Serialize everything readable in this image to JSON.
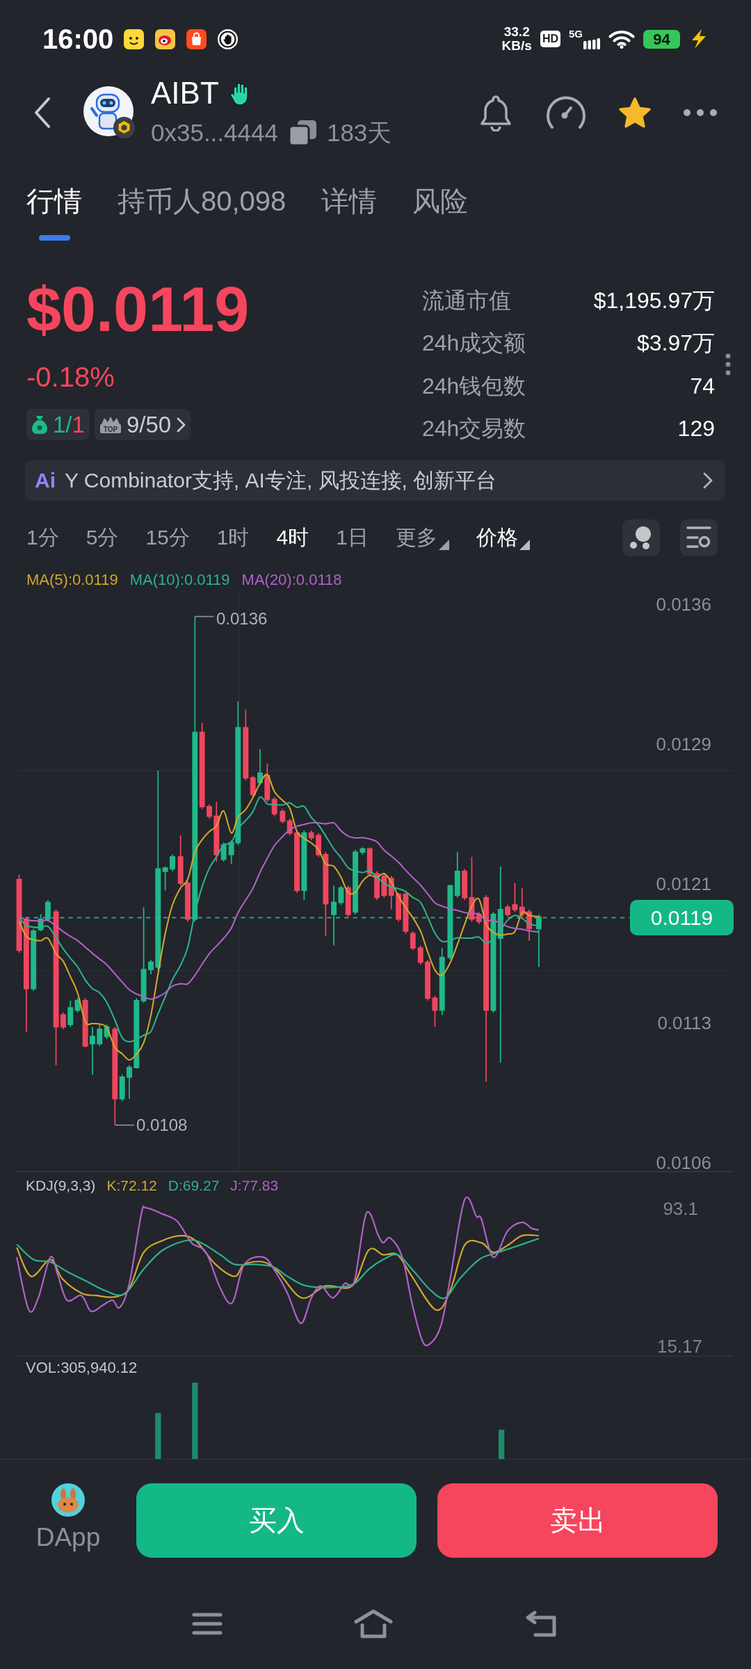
{
  "status_bar": {
    "time": "16:00",
    "speed": "33.2",
    "speed_unit": "KB/s",
    "hd": "HD",
    "network": "5G",
    "battery": "94"
  },
  "header": {
    "token": "AIBT",
    "address": "0x35...4444",
    "age": "183天",
    "favorite": true
  },
  "tabs": [
    {
      "label": "行情",
      "selected": true
    },
    {
      "label": "持币人80,098",
      "selected": false
    },
    {
      "label": "详情",
      "selected": false
    },
    {
      "label": "风险",
      "selected": false
    }
  ],
  "price": {
    "value": "$0.0119",
    "change": "-0.18%"
  },
  "badges": [
    {
      "kind": "holders",
      "parts": [
        {
          "text": "1/",
          "color": "#1fb98a"
        },
        {
          "text": "1",
          "color": "#f6465d"
        }
      ]
    },
    {
      "kind": "rank",
      "icon_text": "TOP",
      "parts": [
        {
          "text": "9/50",
          "color": "#c9ccd1"
        }
      ]
    }
  ],
  "stats": [
    {
      "label": "流通市值",
      "value": "$1,195.97万"
    },
    {
      "label": "24h成交额",
      "value": "$3.97万"
    },
    {
      "label": "24h钱包数",
      "value": "74"
    },
    {
      "label": "24h交易数",
      "value": "129"
    }
  ],
  "banner": {
    "logo": "Ai",
    "text": "Y Combinator支持, AI专注, 风投连接, 创新平台"
  },
  "intervals": [
    {
      "label": "1分",
      "selected": false
    },
    {
      "label": "5分",
      "selected": false
    },
    {
      "label": "15分",
      "selected": false
    },
    {
      "label": "1时",
      "selected": false
    },
    {
      "label": "4时",
      "selected": true
    },
    {
      "label": "1日",
      "selected": false
    }
  ],
  "dropdowns": [
    {
      "label": "更多",
      "active": false
    },
    {
      "label": "价格",
      "active": true
    }
  ],
  "chart": {
    "ma_legend": [
      {
        "label": "MA(5):0.0119",
        "color": "#d1a72e"
      },
      {
        "label": "MA(10):0.0119",
        "color": "#2bb38c"
      },
      {
        "label": "MA(20):0.0118",
        "color": "#b062c9"
      }
    ],
    "axis_labels": [
      "0.0136",
      "0.0129",
      "0.0121",
      "0.0113",
      "0.0106"
    ],
    "high_label": "0.0136",
    "low_label": "0.0108",
    "last_price": "0.0119"
  },
  "kdj": {
    "legend": [
      {
        "label": "KDJ(9,3,3)",
        "color": "#c5c8cd"
      },
      {
        "label": "K:72.12",
        "color": "#d1a72e"
      },
      {
        "label": "D:69.27",
        "color": "#2bb38c"
      },
      {
        "label": "J:77.83",
        "color": "#b062c9"
      }
    ],
    "axis_labels": [
      "93.1",
      "15.17"
    ]
  },
  "volume": {
    "label": "VOL:305,940.12"
  },
  "actions": {
    "dapp": "DApp",
    "buy": "买入",
    "sell": "卖出"
  }
}
